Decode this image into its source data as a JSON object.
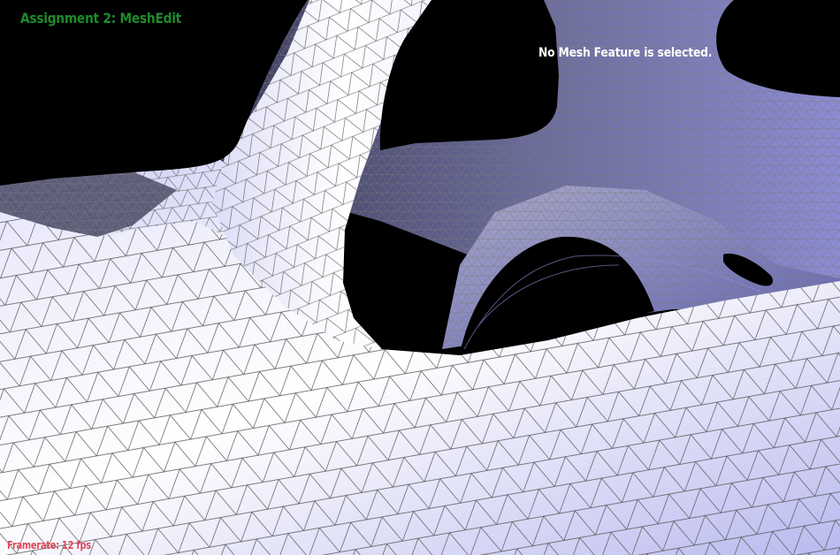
{
  "app": {
    "title": "Assignment 2: MeshEdit"
  },
  "hud": {
    "selection_status": "No Mesh Feature is selected.",
    "framerate": "Framerate: 12 fps"
  },
  "colors": {
    "background": "#000000",
    "title": "#1f8a2c",
    "status": "#ffffff",
    "framerate": "#e0485a",
    "mesh_light": "#ffffff",
    "mesh_shadow": "#6b6bd6",
    "wireframe": "#6e6e6e"
  }
}
